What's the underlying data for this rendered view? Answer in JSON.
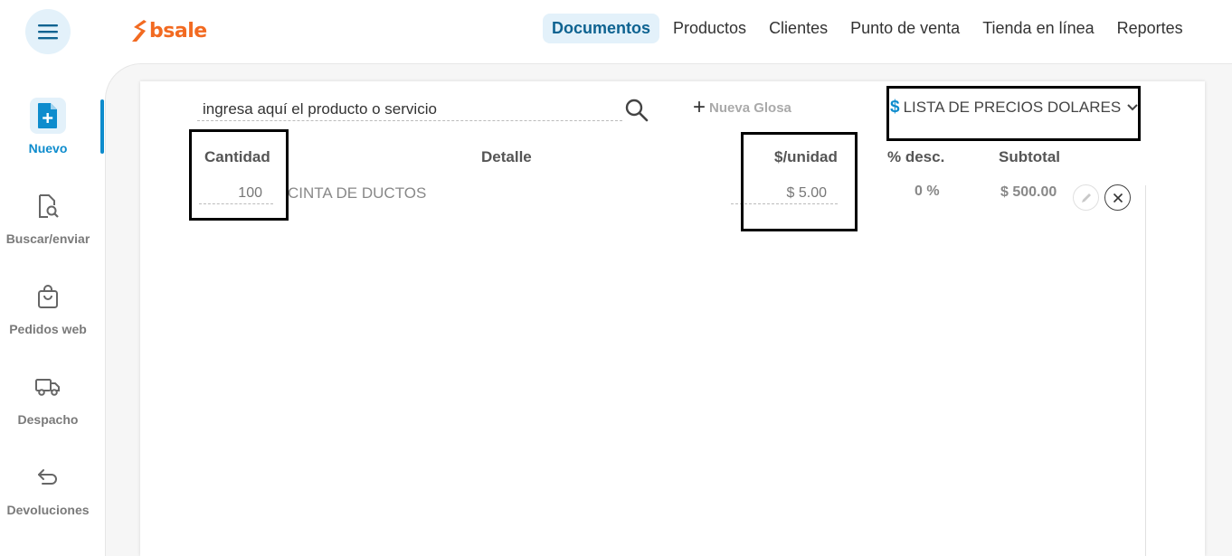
{
  "brand": {
    "name": "bsale",
    "color": "#f26a21",
    "accent": "#0e8ccd"
  },
  "nav": {
    "items": [
      {
        "label": "Documentos",
        "active": true
      },
      {
        "label": "Productos",
        "active": false
      },
      {
        "label": "Clientes",
        "active": false
      },
      {
        "label": "Punto de venta",
        "active": false
      },
      {
        "label": "Tienda en línea",
        "active": false
      },
      {
        "label": "Reportes",
        "active": false
      }
    ]
  },
  "sidebar": {
    "items": [
      {
        "label": "Nuevo",
        "icon": "new-document-icon",
        "active": true
      },
      {
        "label": "Buscar/enviar",
        "icon": "document-search-icon",
        "active": false
      },
      {
        "label": "Pedidos web",
        "icon": "shopping-bag-icon",
        "active": false
      },
      {
        "label": "Despacho",
        "icon": "truck-icon",
        "active": false
      },
      {
        "label": "Devoluciones",
        "icon": "return-arrow-icon",
        "active": false
      }
    ]
  },
  "search": {
    "placeholder": "ingresa aquí el producto o servicio",
    "icon": "search-icon"
  },
  "glosa": {
    "label": "Nueva Glosa"
  },
  "pricelist": {
    "symbol": "$",
    "label": "LISTA DE PRECIOS DOLARES"
  },
  "table": {
    "headers": {
      "cantidad": "Cantidad",
      "detalle": "Detalle",
      "unidad": "$/unidad",
      "desc": "% desc.",
      "subtotal": "Subtotal"
    },
    "rows": [
      {
        "cantidad": "100",
        "detalle": "CINTA DE DUCTOS",
        "unidad": "$ 5.00",
        "desc": "0 %",
        "subtotal": "$ 500.00"
      }
    ]
  }
}
